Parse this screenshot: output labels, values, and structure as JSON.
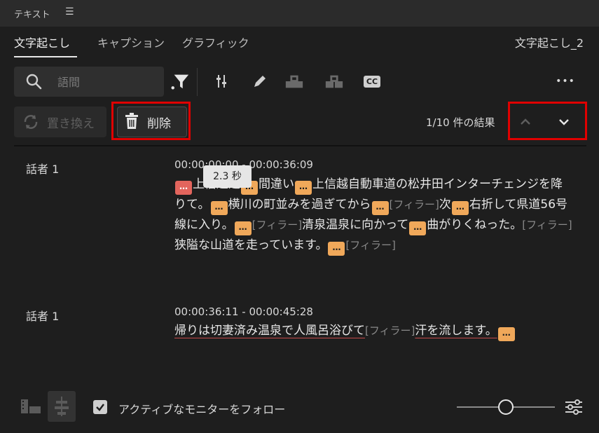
{
  "panel": {
    "title": "テキスト",
    "menu_icon": "hamburger-icon"
  },
  "tabs": [
    {
      "label": "文字起こし",
      "active": true
    },
    {
      "label": "キャプション",
      "active": false
    },
    {
      "label": "グラフィック",
      "active": false
    }
  ],
  "sequence_name": "文字起こし_2",
  "search": {
    "value": "",
    "placeholder": "語間"
  },
  "toolbar": {
    "icons": [
      "filter-icon",
      "sliders-icon",
      "pencil-icon",
      "merge-clips-icon",
      "split-clips-icon",
      "cc-icon",
      "more-icon"
    ],
    "cc_label": "CC",
    "more_label": "•••"
  },
  "actions": {
    "replace_label": "置き換え",
    "delete_label": "削除",
    "results": "1/10 件の結果"
  },
  "transcript": [
    {
      "speaker": "話者 1",
      "timecode": "00:00:00:00 - 00:00:36:09",
      "tokens": [
        {
          "t": "pause",
          "sel": true
        },
        {
          "t": "text",
          "v": "上信越道"
        },
        {
          "t": "pause"
        },
        {
          "t": "text",
          "v": "間違い"
        },
        {
          "t": "pause"
        },
        {
          "t": "text",
          "v": "上信越自動車道の松井田インターチェンジを降りて。"
        },
        {
          "t": "pause"
        },
        {
          "t": "text",
          "v": "横川の町並みを過ぎてから"
        },
        {
          "t": "pause"
        },
        {
          "t": "filler",
          "v": "[フィラー]"
        },
        {
          "t": "text",
          "v": "次"
        },
        {
          "t": "pause"
        },
        {
          "t": "text",
          "v": "右折して県道56号線に入り。"
        },
        {
          "t": "pause"
        },
        {
          "t": "filler",
          "v": "[フィラー]"
        },
        {
          "t": "text",
          "v": "清泉温泉に向かって"
        },
        {
          "t": "pause"
        },
        {
          "t": "text",
          "v": "曲がりくねった。"
        },
        {
          "t": "filler",
          "v": "[フィラー]"
        },
        {
          "t": "text",
          "v": "狭隘な山道を走っています。"
        },
        {
          "t": "pause"
        },
        {
          "t": "filler",
          "v": "[フィラー]"
        }
      ]
    },
    {
      "speaker": "話者 1",
      "timecode": "00:00:36:11 - 00:00:45:28",
      "tokens": [
        {
          "t": "text",
          "v": "帰りは切妻済み温泉で人風呂浴びて",
          "u": true
        },
        {
          "t": "filler",
          "v": "[フィラー]"
        },
        {
          "t": "text",
          "v": "汗を流します。",
          "u": true
        },
        {
          "t": "pause"
        }
      ]
    }
  ],
  "pause_glyph": "…",
  "tooltip": "2.3 秒",
  "footer": {
    "follow_label": "アクティブなモニターをフォロー",
    "follow_checked": true,
    "zoom_level": 0.5
  }
}
